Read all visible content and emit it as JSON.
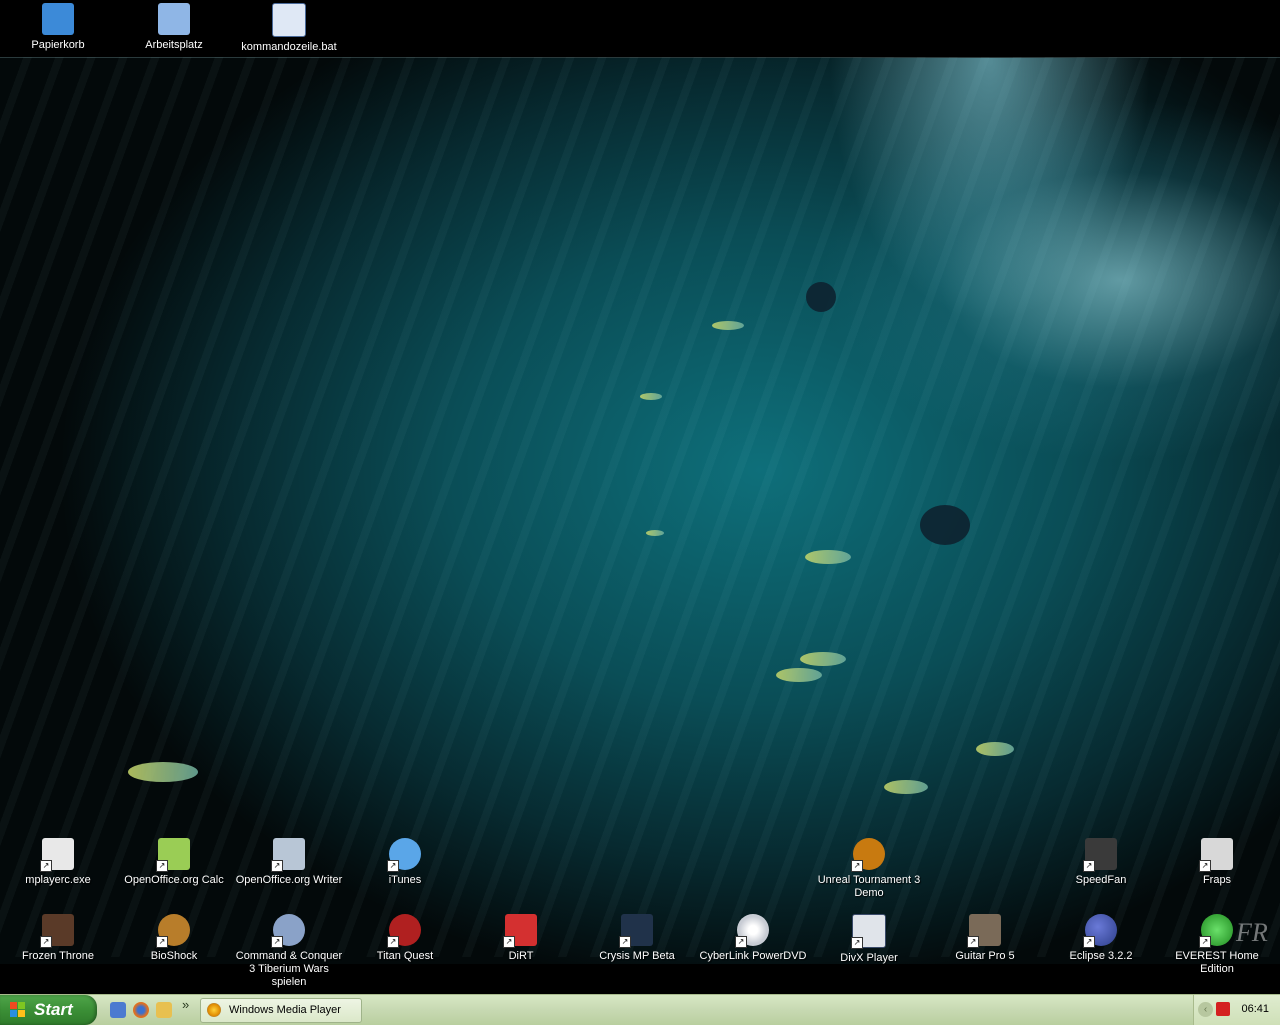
{
  "desktop": {
    "top_icons": [
      {
        "label": "Papierkorb",
        "icon": "recycle-bin-icon",
        "color": "#3c8ad8"
      },
      {
        "label": "Arbeitsplatz",
        "icon": "my-computer-icon",
        "color": "#8fb6e6"
      },
      {
        "label": "kommandozeile.bat",
        "icon": "batch-file-icon",
        "color": "#dfe8f5"
      }
    ],
    "row1_icons": [
      {
        "label": "mplayerc.exe",
        "icon": "media-player-classic-icon",
        "color": "#e8e8e8"
      },
      {
        "label": "OpenOffice.org Calc",
        "icon": "openoffice-calc-icon",
        "color": "#9acd55"
      },
      {
        "label": "OpenOffice.org Writer",
        "icon": "openoffice-writer-icon",
        "color": "#b8c6d6"
      },
      {
        "label": "iTunes",
        "icon": "itunes-icon",
        "color": "#5aa6e8"
      },
      {
        "label": "Unreal Tournament 3 Demo",
        "icon": "unreal-tournament-icon",
        "color": "#c87a10"
      },
      {
        "label": "SpeedFan",
        "icon": "speedfan-icon",
        "color": "#3a3a3a"
      },
      {
        "label": "Fraps",
        "icon": "fraps-icon",
        "color": "#d8d8d8"
      }
    ],
    "row2_icons": [
      {
        "label": "Frozen Throne",
        "icon": "frozen-throne-icon",
        "color": "#5a3a28"
      },
      {
        "label": "BioShock",
        "icon": "bioshock-icon",
        "color": "#b87d2a"
      },
      {
        "label": "Command & Conquer 3 Tiberium Wars spielen",
        "icon": "command-conquer-icon",
        "color": "#8aa2c8"
      },
      {
        "label": "Titan Quest",
        "icon": "titan-quest-icon",
        "color": "#b02020"
      },
      {
        "label": "DiRT",
        "icon": "dirt-icon",
        "color": "#d43030"
      },
      {
        "label": "Crysis MP Beta",
        "icon": "crysis-icon",
        "color": "#20324a"
      },
      {
        "label": "CyberLink PowerDVD",
        "icon": "powerdvd-icon",
        "color": "#d02828"
      },
      {
        "label": "DivX Player",
        "icon": "divx-player-icon",
        "color": "#e0e4ea"
      },
      {
        "label": "Guitar Pro 5",
        "icon": "guitar-pro-icon",
        "color": "#7a6a58"
      },
      {
        "label": "Eclipse 3.2.2",
        "icon": "eclipse-icon",
        "color": "#2d3e8a"
      },
      {
        "label": "EVEREST Home Edition",
        "icon": "everest-icon",
        "color": "#3cb83c"
      }
    ],
    "watermark": "FR"
  },
  "taskbar": {
    "start_label": "Start",
    "quick_launch": [
      {
        "icon": "show-desktop-icon",
        "color": "#4c7ad0"
      },
      {
        "icon": "firefox-icon",
        "color": "#e07020"
      },
      {
        "icon": "explorer-icon",
        "color": "#e8c050"
      }
    ],
    "overflow_label": "»",
    "tasks": [
      {
        "label": "Windows Media Player",
        "icon": "windows-media-player-icon"
      }
    ],
    "tray": {
      "clock": "06:41",
      "expand_label": "‹",
      "icons": [
        {
          "icon": "antivir-icon",
          "color": "#d42020"
        }
      ]
    }
  }
}
